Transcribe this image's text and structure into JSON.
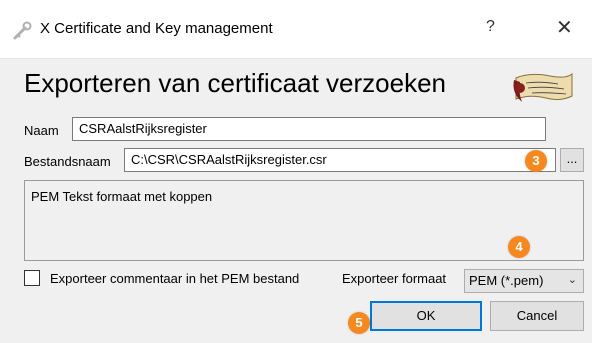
{
  "window": {
    "title": "X Certificate and Key management",
    "help_label": "?",
    "close_label": "✕"
  },
  "dialog": {
    "heading": "Exporteren van certificaat verzoeken",
    "name_label": "Naam",
    "name_value": "CSRAalstRijksregister",
    "filename_label": "Bestandsnaam",
    "filename_value": "C:\\CSR\\CSRAalstRijksregister.csr",
    "browse_label": "...",
    "description": "PEM Tekst formaat met koppen",
    "export_comment_label": "Exporteer commentaar in het PEM bestand",
    "export_comment_checked": false,
    "format_label": "Exporteer formaat",
    "format_value": "PEM (*.pem)",
    "ok_label": "OK",
    "cancel_label": "Cancel"
  },
  "badges": [
    "3",
    "4",
    "5"
  ],
  "colors": {
    "badge": "#f5891f",
    "default_button_border": "#0078d7"
  }
}
